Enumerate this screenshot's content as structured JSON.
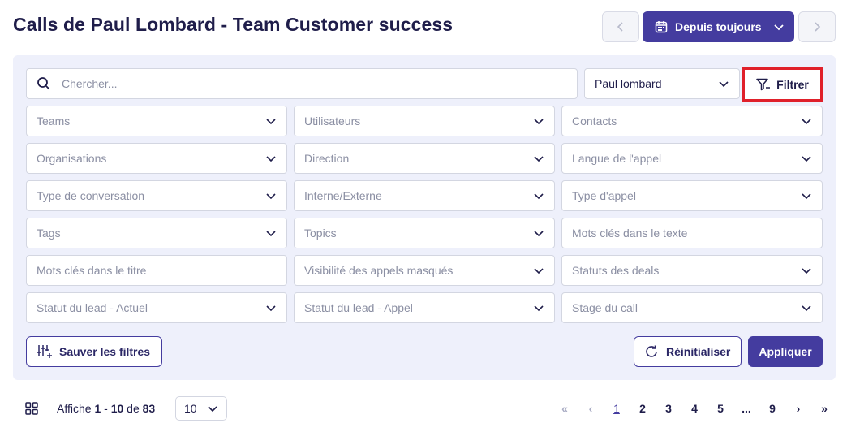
{
  "header": {
    "title": "Calls de Paul Lombard - Team Customer success",
    "date_range": "Depuis toujours"
  },
  "search": {
    "placeholder": "Chercher..."
  },
  "user_filter": {
    "value": "Paul lombard"
  },
  "filter_button": {
    "label": "Filtrer"
  },
  "filters": [
    [
      "Teams",
      "Utilisateurs",
      "Contacts"
    ],
    [
      "Organisations",
      "Direction",
      "Langue de l'appel"
    ],
    [
      "Type de conversation",
      "Interne/Externe",
      "Type d'appel"
    ],
    [
      "Tags",
      "Topics",
      "Mots clés dans le texte"
    ],
    [
      "Mots clés dans le titre",
      "Visibilité des appels masqués",
      "Statuts des deals"
    ],
    [
      "Statut du lead - Actuel",
      "Statut du lead - Appel",
      "Stage du call"
    ]
  ],
  "actions": {
    "save": "Sauver les filtres",
    "reset": "Réinitialiser",
    "apply": "Appliquer"
  },
  "footer": {
    "showing_prefix": "Affiche",
    "range_start": "1",
    "range_sep": "-",
    "range_end": "10",
    "of": "de",
    "total": "83",
    "per_page": "10"
  },
  "pagination": {
    "first": "«",
    "prev": "‹",
    "pages": [
      "1",
      "2",
      "3",
      "4",
      "5",
      "...",
      "9"
    ],
    "next": "›",
    "last": "»",
    "current": "1"
  },
  "colors": {
    "primary": "#443c9f",
    "panel": "#eef0fb",
    "highlight": "#e0202a"
  }
}
